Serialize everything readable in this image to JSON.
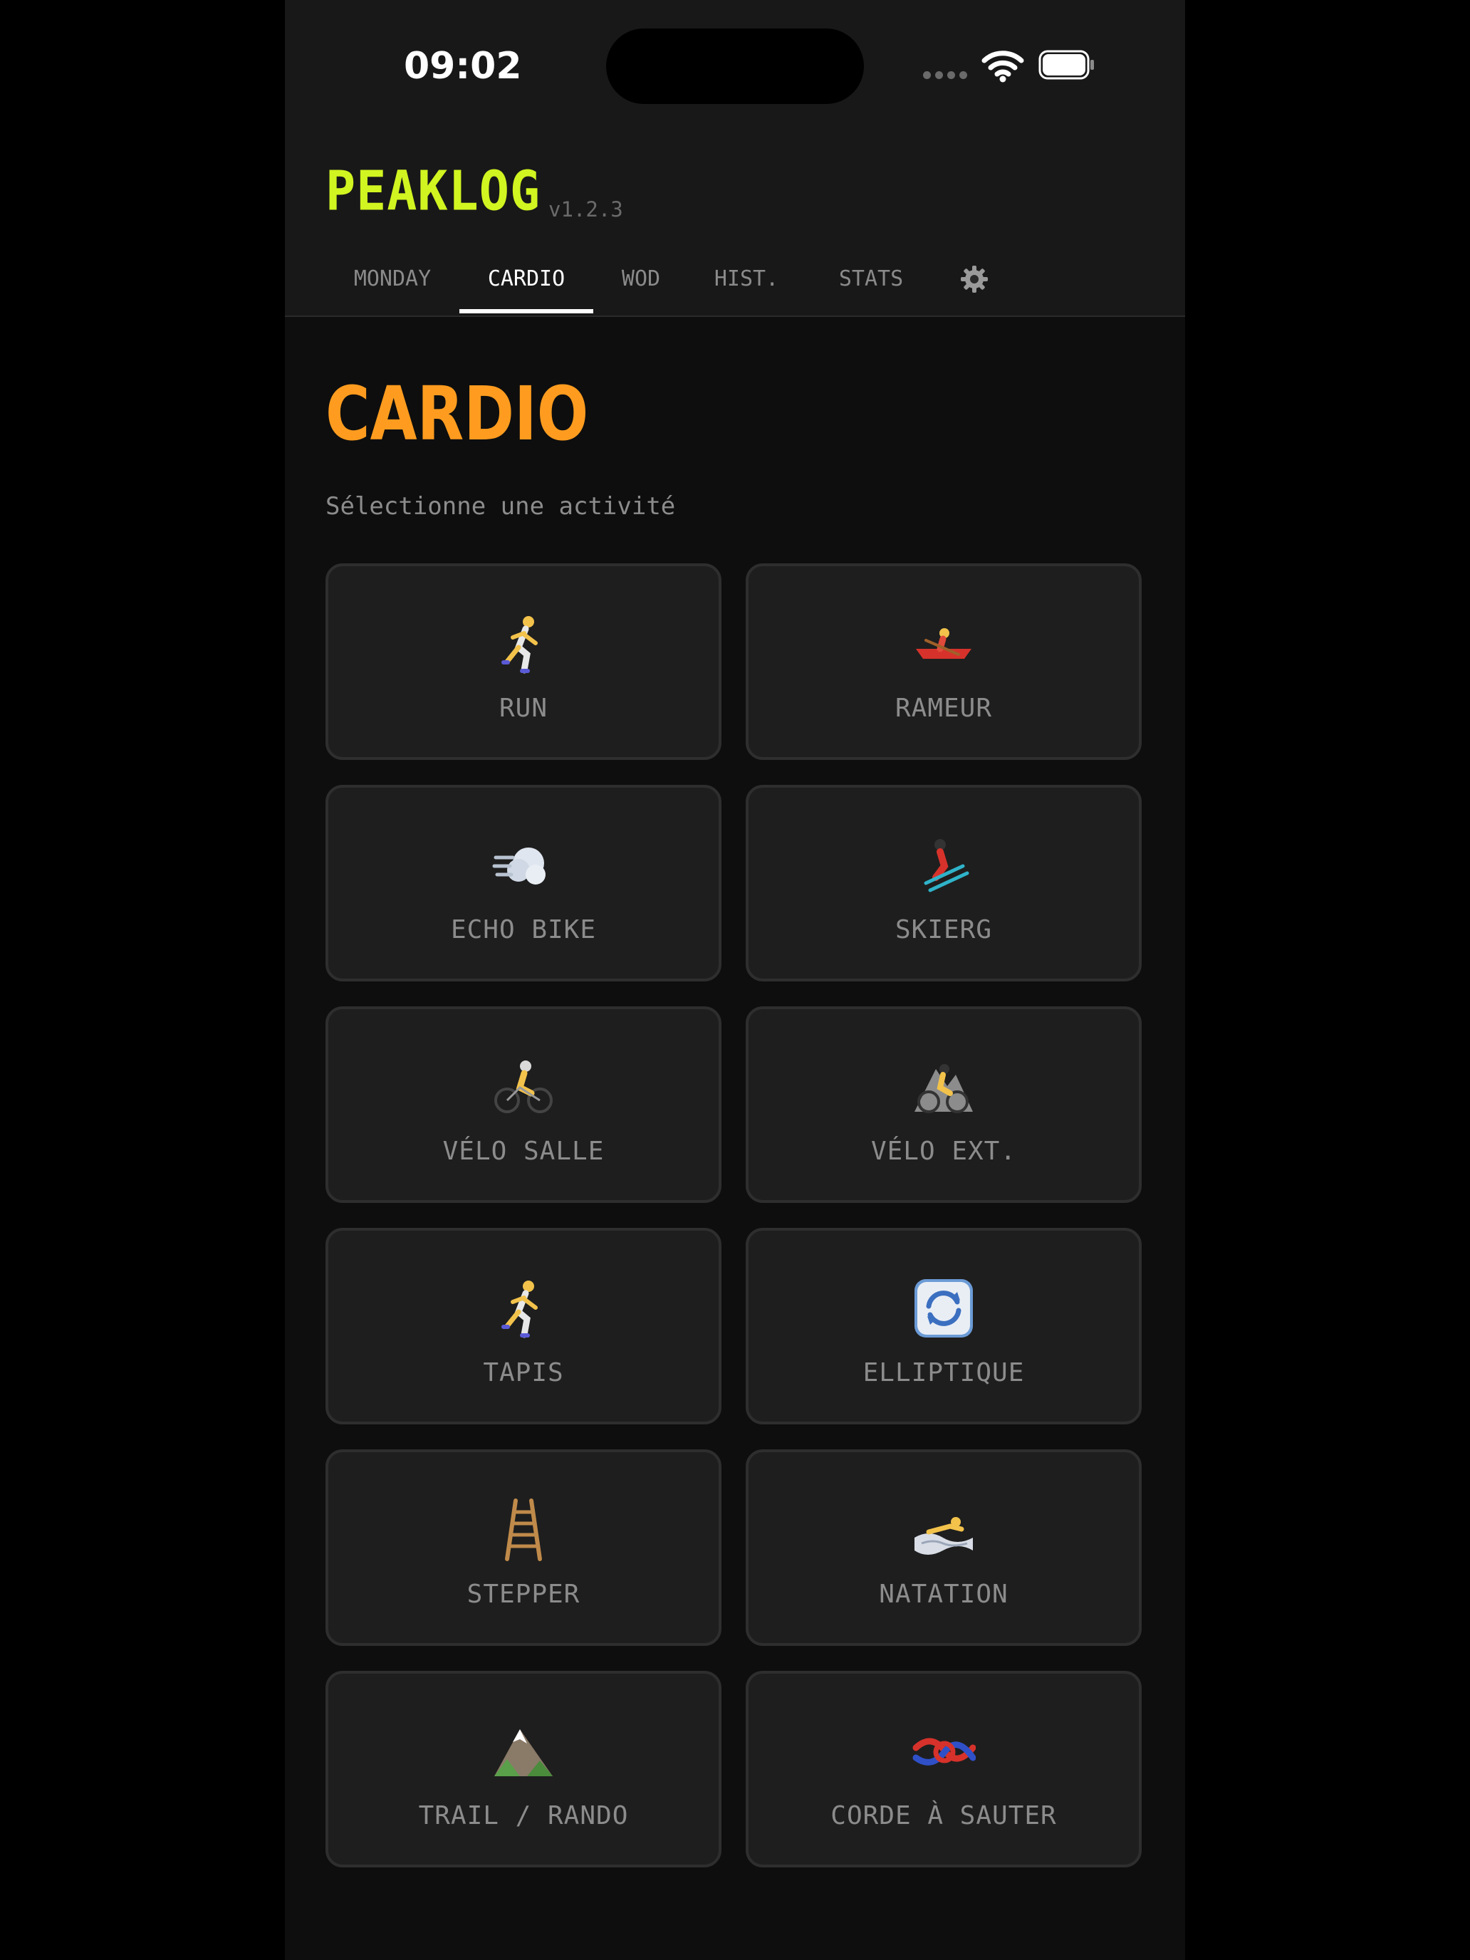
{
  "status_bar": {
    "time": "09:02"
  },
  "header": {
    "app_name": "PEAKLOG",
    "version": "v1.2.3"
  },
  "tabs": [
    {
      "label": "MONDAY"
    },
    {
      "label": "CARDIO"
    },
    {
      "label": "WOD"
    },
    {
      "label": "HIST."
    },
    {
      "label": "STATS"
    }
  ],
  "active_tab": "CARDIO",
  "settings_icon": "gear-icon",
  "page": {
    "title": "CARDIO",
    "subtitle": "Sélectionne une activité"
  },
  "activities": [
    {
      "label": "RUN",
      "icon": "runner-icon"
    },
    {
      "label": "RAMEUR",
      "icon": "rowboat-icon"
    },
    {
      "label": "ECHO BIKE",
      "icon": "wind-icon"
    },
    {
      "label": "SKIERG",
      "icon": "skier-icon"
    },
    {
      "label": "VÉLO SALLE",
      "icon": "cyclist-icon"
    },
    {
      "label": "VÉLO EXT.",
      "icon": "mountain-biker-icon"
    },
    {
      "label": "TAPIS",
      "icon": "runner-icon"
    },
    {
      "label": "ELLIPTIQUE",
      "icon": "refresh-icon"
    },
    {
      "label": "STEPPER",
      "icon": "ladder-icon"
    },
    {
      "label": "NATATION",
      "icon": "swimmer-icon"
    },
    {
      "label": "TRAIL / RANDO",
      "icon": "mountain-icon"
    },
    {
      "label": "CORDE À SAUTER",
      "icon": "knot-icon"
    }
  ],
  "colors": {
    "logo": "#d1f520",
    "title": "#ff9c1f",
    "card_bg": "#1e1e1e",
    "card_border": "#2e2e2e",
    "text_muted": "#8c8c8c"
  }
}
